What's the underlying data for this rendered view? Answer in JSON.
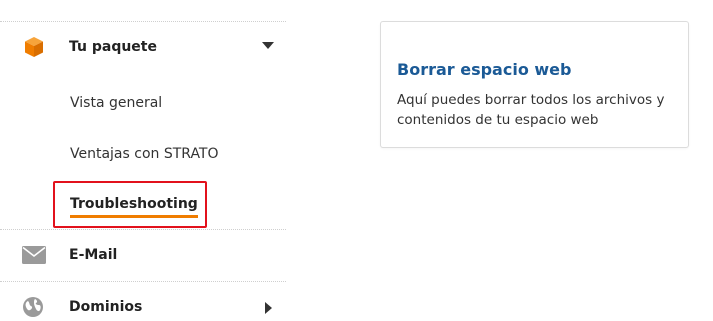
{
  "sidebar": {
    "sections": [
      {
        "label": "Tu paquete",
        "icon": "package-icon",
        "expanded": true
      },
      {
        "label": "E-Mail",
        "icon": "envelope-icon"
      },
      {
        "label": "Dominios",
        "icon": "globe-icon",
        "expanded": false
      }
    ],
    "subitems": [
      {
        "label": "Vista general"
      },
      {
        "label": "Ventajas con STRATO"
      },
      {
        "label": "Troubleshooting",
        "active": true
      }
    ]
  },
  "card": {
    "title": "Borrar espacio web",
    "description": "Aquí puedes borrar todos los archivos y contenidos de tu espacio web"
  },
  "colors": {
    "accent": "#f07d00",
    "highlight_border": "#e2111c",
    "link_title": "#1b5a96",
    "icon_gray": "#9a9a9a"
  }
}
